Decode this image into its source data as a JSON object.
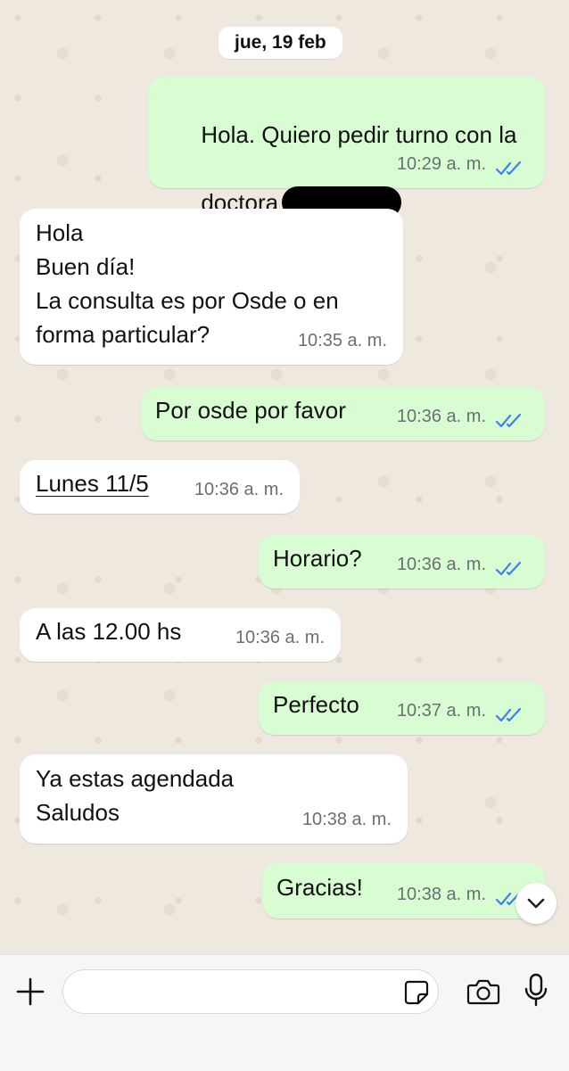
{
  "date_separator": "jue, 19 feb",
  "messages": [
    {
      "direction": "out",
      "text_line1": "Hola. Quiero pedir turno con la",
      "text_line2": "doctora",
      "redacted": true,
      "time": "10:29 a. m.",
      "read": true
    },
    {
      "direction": "in",
      "text": "Hola\nBuen día!\nLa consulta es por Osde o en\nforma particular?",
      "time": "10:35 a. m."
    },
    {
      "direction": "out",
      "text": "Por osde por favor",
      "time": "10:36 a. m.",
      "read": true
    },
    {
      "direction": "in",
      "text": "Lunes 11/5",
      "time": "10:36 a. m."
    },
    {
      "direction": "out",
      "text": "Horario?",
      "time": "10:36 a. m.",
      "read": true
    },
    {
      "direction": "in",
      "text": "A las 12.00 hs",
      "time": "10:36 a. m."
    },
    {
      "direction": "out",
      "text": "Perfecto",
      "time": "10:37 a. m.",
      "read": true
    },
    {
      "direction": "in",
      "text": "Ya estas agendada\nSaludos",
      "time": "10:38 a. m."
    },
    {
      "direction": "out",
      "text": "Gracias!",
      "time": "10:38 a. m.",
      "read": true
    }
  ],
  "composer": {
    "placeholder": ""
  },
  "icons": {
    "add": "plus-icon",
    "sticker": "sticker-icon",
    "camera": "camera-icon",
    "mic": "microphone-icon",
    "scroll": "chevron-down-icon",
    "read_receipt": "double-check-icon"
  },
  "colors": {
    "outgoing_bubble": "#d9fdd3",
    "incoming_bubble": "#ffffff",
    "read_tick": "#3b82f6",
    "chat_background": "#efe8df"
  }
}
